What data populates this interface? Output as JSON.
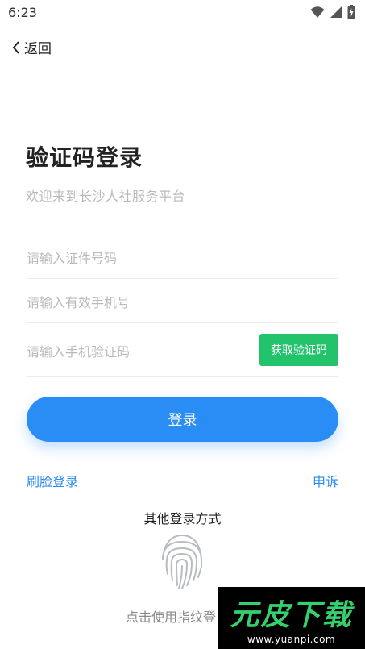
{
  "status_bar": {
    "time": "6:23",
    "icons": [
      "wifi-icon",
      "cellular-signal-icon",
      "battery-charging-icon"
    ]
  },
  "nav": {
    "back_label": "返回"
  },
  "header": {
    "title": "验证码登录",
    "subtitle": "欢迎来到长沙人社服务平台"
  },
  "form": {
    "id_number_placeholder": "请输入证件号码",
    "phone_placeholder": "请输入有效手机号",
    "code_placeholder": "请输入手机验证码",
    "get_code_label": "获取验证码",
    "login_label": "登录"
  },
  "links": {
    "face_login": "刷脸登录",
    "appeal": "申诉"
  },
  "other_methods": {
    "title": "其他登录方式",
    "fingerprint_label": "点击使用指纹登"
  },
  "watermark": {
    "logo_text": "元皮下载",
    "url": "www.yuanpi.com"
  },
  "colors": {
    "primary": "#2a8df5",
    "success": "#22c36b",
    "placeholder": "#b9b9b9"
  }
}
